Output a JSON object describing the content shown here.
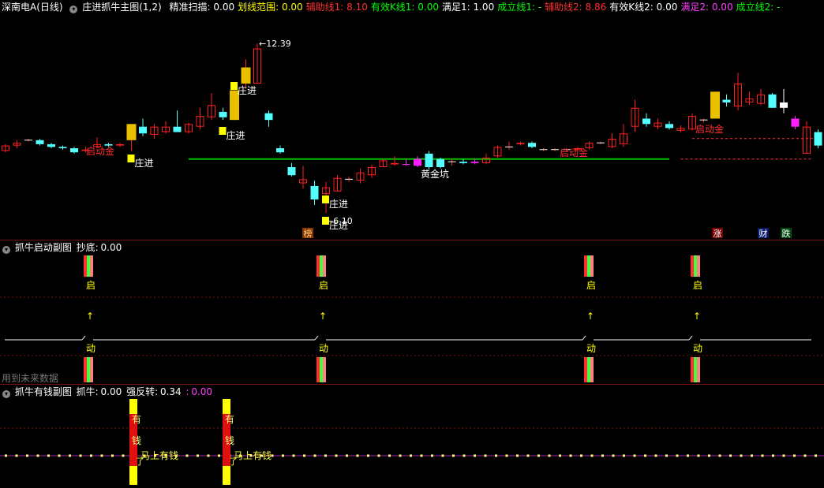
{
  "header": {
    "stock": "深南电A(日线)",
    "indicator": "庄进抓牛主图(1,2)",
    "items": [
      {
        "label": "精准扫描: ",
        "value": "0.00",
        "color": "#ffffff"
      },
      {
        "label": "划线范围: ",
        "value": "0.00",
        "color": "#ffff00"
      },
      {
        "label": "辅助线1: ",
        "value": "8.10",
        "color": "#ff3030"
      },
      {
        "label": "有效K线1: ",
        "value": "0.00",
        "color": "#00ff00"
      },
      {
        "label": "满足1: ",
        "value": "1.00",
        "color": "#ffffff"
      },
      {
        "label": "成立线1: ",
        "value": "-",
        "color": "#00ff00"
      },
      {
        "label": "辅助线2: ",
        "value": "8.86",
        "color": "#ff3030"
      },
      {
        "label": "有效K线2: ",
        "value": "0.00",
        "color": "#ffffff"
      },
      {
        "label": "满足2: ",
        "value": "0.00",
        "color": "#ff40ff"
      },
      {
        "label": "成立线2: ",
        "value": "-",
        "color": "#00ff00"
      }
    ]
  },
  "chart_data": [
    {
      "type": "candlestick",
      "high_label": "12.39",
      "low_label": "6.10",
      "support_line": 8.1,
      "resist_line": 8.86,
      "ylim": [
        5.4,
        13.3
      ],
      "candles": [
        [
          8.4,
          8.6,
          8.65,
          8.35
        ],
        [
          8.6,
          8.7,
          8.8,
          8.5
        ],
        [
          8.8,
          8.8,
          8.85,
          8.75
        ],
        [
          8.8,
          8.65,
          8.85,
          8.6
        ],
        [
          8.65,
          8.55,
          8.7,
          8.5
        ],
        [
          8.55,
          8.5,
          8.6,
          8.45
        ],
        [
          8.5,
          8.35,
          8.55,
          8.3
        ],
        [
          8.4,
          8.45,
          8.55,
          8.35
        ],
        [
          8.55,
          8.65,
          8.9,
          8.5
        ],
        [
          8.65,
          8.6,
          8.7,
          8.55
        ],
        [
          8.6,
          8.65,
          8.7,
          8.55
        ],
        [
          8.8,
          9.4,
          9.4,
          8.4
        ],
        [
          9.3,
          9.05,
          9.6,
          8.95
        ],
        [
          9.0,
          9.3,
          9.4,
          8.85
        ],
        [
          9.1,
          9.3,
          9.5,
          9.05
        ],
        [
          9.3,
          9.1,
          9.9,
          9.1
        ],
        [
          9.1,
          9.4,
          9.45,
          9.05
        ],
        [
          9.3,
          9.7,
          10.0,
          9.2
        ],
        [
          9.65,
          10.1,
          10.55,
          9.55
        ],
        [
          9.85,
          9.65,
          10.0,
          9.55
        ],
        [
          9.55,
          10.65,
          10.65,
          9.55
        ],
        [
          10.9,
          11.5,
          11.8,
          10.7
        ],
        [
          10.9,
          12.2,
          12.39,
          10.9
        ],
        [
          9.8,
          9.55,
          9.9,
          9.3
        ],
        [
          8.5,
          8.35,
          8.6,
          8.3
        ],
        [
          7.8,
          7.5,
          7.95,
          7.45
        ],
        [
          7.2,
          7.35,
          7.85,
          7.0
        ],
        [
          7.1,
          6.6,
          7.3,
          6.4
        ],
        [
          6.8,
          7.05,
          7.25,
          6.1
        ],
        [
          6.9,
          7.4,
          7.5,
          6.9
        ],
        [
          7.35,
          7.35,
          7.45,
          7.25
        ],
        [
          7.3,
          7.6,
          7.75,
          7.2
        ],
        [
          7.5,
          7.8,
          7.9,
          7.4
        ],
        [
          7.8,
          8.05,
          8.1,
          7.8
        ],
        [
          7.9,
          7.95,
          8.2,
          7.85
        ],
        [
          7.9,
          7.9,
          8.1,
          7.85
        ],
        [
          7.85,
          8.1,
          8.2,
          7.8
        ],
        [
          8.3,
          7.8,
          8.4,
          7.7
        ],
        [
          8.1,
          7.8,
          8.15,
          7.75
        ],
        [
          8.0,
          8.0,
          8.1,
          7.85
        ],
        [
          8.0,
          7.95,
          8.1,
          7.9
        ],
        [
          7.95,
          8.0,
          8.1,
          7.9
        ],
        [
          7.95,
          8.15,
          8.3,
          7.9
        ],
        [
          8.2,
          8.55,
          8.6,
          8.15
        ],
        [
          8.55,
          8.55,
          8.75,
          8.45
        ],
        [
          8.65,
          8.7,
          8.75,
          8.6
        ],
        [
          8.7,
          8.55,
          8.75,
          8.5
        ],
        [
          8.45,
          8.45,
          8.5,
          8.4
        ],
        [
          8.45,
          8.45,
          8.5,
          8.4
        ],
        [
          8.45,
          8.45,
          8.5,
          8.4
        ],
        [
          8.45,
          8.5,
          8.55,
          8.4
        ],
        [
          8.5,
          8.7,
          8.75,
          8.45
        ],
        [
          8.7,
          8.7,
          8.75,
          8.65
        ],
        [
          8.55,
          8.85,
          9.05,
          8.5
        ],
        [
          8.65,
          9.05,
          9.4,
          8.55
        ],
        [
          9.3,
          10.0,
          10.3,
          9.1
        ],
        [
          9.6,
          9.4,
          9.8,
          9.3
        ],
        [
          9.3,
          9.45,
          9.6,
          9.2
        ],
        [
          9.4,
          9.25,
          9.5,
          9.2
        ],
        [
          9.15,
          9.25,
          9.35,
          9.1
        ],
        [
          9.2,
          9.7,
          9.8,
          9.15
        ],
        [
          9.55,
          9.55,
          9.6,
          9.45
        ],
        [
          9.6,
          10.6,
          10.6,
          9.6
        ],
        [
          10.3,
          10.2,
          10.5,
          10.05
        ],
        [
          10.05,
          10.9,
          11.3,
          9.9
        ],
        [
          10.2,
          10.35,
          10.6,
          10.1
        ],
        [
          10.15,
          10.5,
          10.7,
          10.1
        ],
        [
          10.5,
          10.0,
          10.55,
          10.0
        ],
        [
          10.2,
          10.0,
          10.7,
          9.8
        ],
        [
          9.6,
          9.3,
          9.7,
          9.2
        ],
        [
          8.3,
          9.3,
          9.5,
          8.3
        ],
        [
          9.1,
          8.6,
          9.2,
          8.5
        ]
      ],
      "labels": [
        "启动金",
        "庄进",
        "庄进",
        "庄进",
        "庄进",
        "庄进",
        "庄进",
        "黄金坑",
        "启动金",
        "启动金"
      ],
      "bottom_tags": [
        {
          "text": "榜",
          "bg": "#8a3a00",
          "fg": "#ffd080"
        },
        {
          "text": "涨",
          "bg": "#7a0000",
          "fg": "#ffffff"
        },
        {
          "text": "财",
          "bg": "#0a1a6a",
          "fg": "#ffffff"
        },
        {
          "text": "跌",
          "bg": "#004a10",
          "fg": "#ffffff"
        }
      ]
    },
    {
      "type": "signal",
      "title": "抓牛启动副图",
      "label": "抄底: ",
      "value": "0.00",
      "signal_index": [
        7,
        27,
        50,
        59
      ],
      "top_char": "启",
      "bottom_char": "动",
      "arrow_char": "↑",
      "note": "用到未来数据"
    },
    {
      "type": "signal",
      "title": "抓牛有钱副图",
      "label1": "抓牛: ",
      "value1": "0.00",
      "label2": "强反转: ",
      "value2": "0.34",
      "label3": ": ",
      "value3": "0.00",
      "signal_index": [
        11,
        19
      ],
      "chars": [
        "有",
        "钱"
      ],
      "sub_label": "马上有钱",
      "hook": "了"
    }
  ],
  "colors": {
    "up": "#ff2020",
    "down": "#54ffff",
    "support": "#00c000",
    "resist": "#ff3030",
    "gold": "#e8c000",
    "magenta": "#ff20ff"
  }
}
